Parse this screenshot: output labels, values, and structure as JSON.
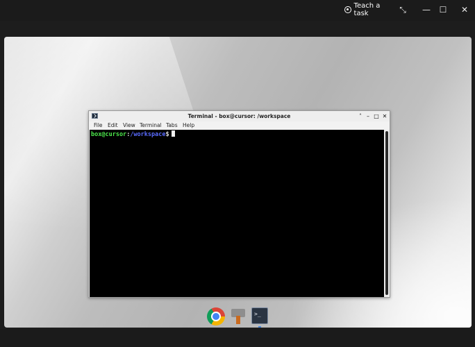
{
  "app": {
    "teach_task_label": "Teach a task",
    "restore_symbol": "⤡",
    "minimize_symbol": "—",
    "maximize_symbol": "☐",
    "close_symbol": "✕"
  },
  "terminal": {
    "title": "Terminal - box@cursor: /workspace",
    "title_controls": {
      "minimize": "˄",
      "shade": "–",
      "maximize": "□",
      "close": "✕"
    },
    "menu": [
      "File",
      "Edit",
      "View",
      "Terminal",
      "Tabs",
      "Help"
    ],
    "prompt": {
      "user_host": "box@cursor",
      "colon": ":",
      "path": "/workspace",
      "symbol": "$"
    },
    "colors": {
      "user_host": "#4de94c",
      "path": "#5a6cff",
      "background": "#000000"
    }
  },
  "dock": {
    "items": [
      {
        "icon": "chrome-icon"
      },
      {
        "icon": "file-manager-icon"
      },
      {
        "icon": "terminal-icon",
        "label": ">_",
        "active": true
      }
    ]
  }
}
